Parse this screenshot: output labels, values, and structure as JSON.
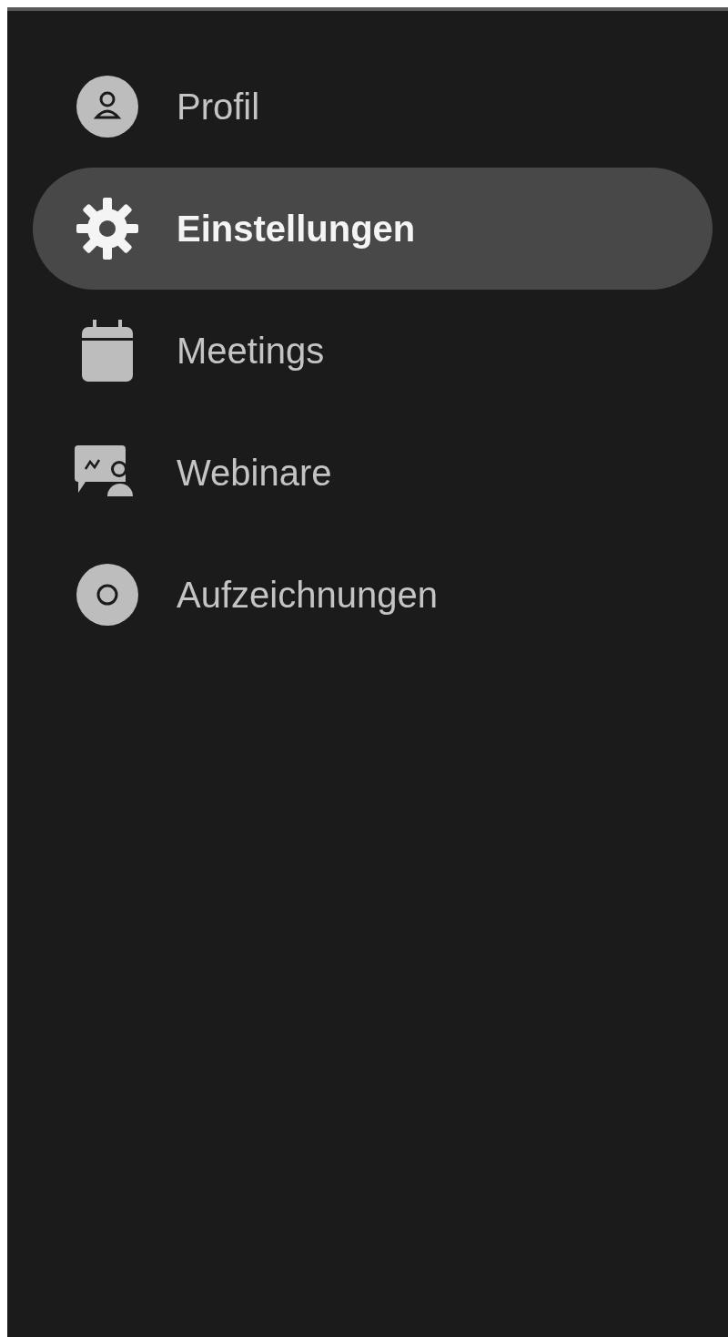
{
  "sidebar": {
    "items": [
      {
        "label": "Profil",
        "selected": false
      },
      {
        "label": "Einstellungen",
        "selected": true
      },
      {
        "label": "Meetings",
        "selected": false
      },
      {
        "label": "Webinare",
        "selected": false
      },
      {
        "label": "Aufzeichnungen",
        "selected": false
      }
    ]
  }
}
